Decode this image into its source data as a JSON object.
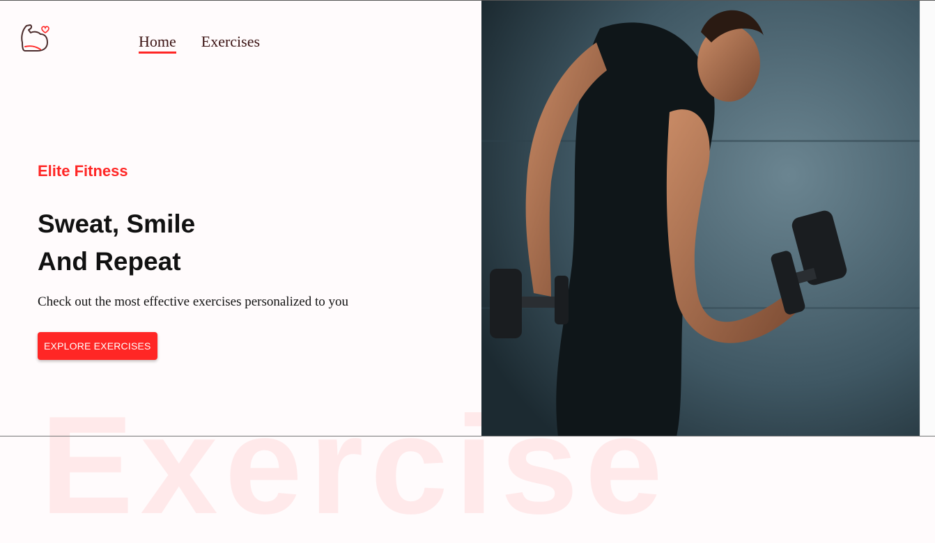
{
  "nav": {
    "links": [
      {
        "label": "Home",
        "active": true
      },
      {
        "label": "Exercises",
        "active": false
      }
    ]
  },
  "hero": {
    "tagline": "Elite Fitness",
    "headline_line1": "Sweat, Smile",
    "headline_line2": "And Repeat",
    "subtext": "Check out the most effective exercises personalized to you",
    "cta_label": "EXPLORE EXERCISES",
    "watermark": "Exercise"
  },
  "colors": {
    "accent": "#ff2625",
    "background": "#fffbfc",
    "nav_text": "#3a1212"
  },
  "icons": {
    "logo": "flexed-arm-heart-icon"
  }
}
